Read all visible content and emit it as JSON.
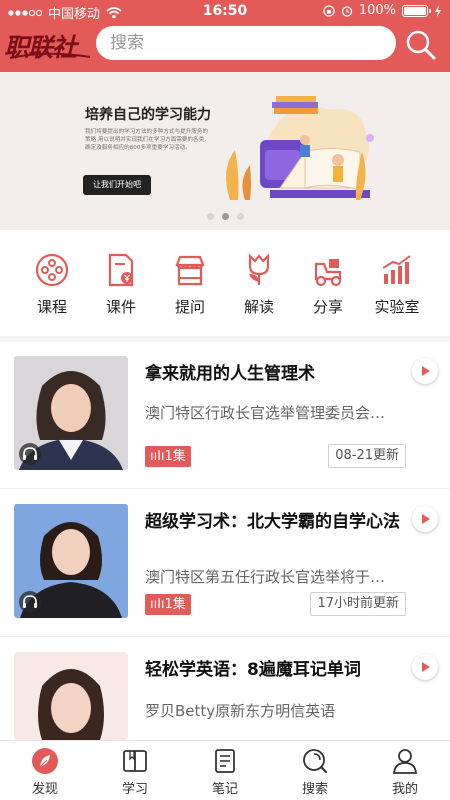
{
  "status_bar": {
    "carrier": "中国移动",
    "time": "16:50",
    "battery": "100%"
  },
  "header": {
    "logo_text": "职联社",
    "search_placeholder": "搜索"
  },
  "banner": {
    "title": "培养自己的学习能力",
    "description": "我们将要提出的学习方法的多种方式与提升服务的策略,用以说明并实现我们在学习方面需要的各类,确定及服务相应的800多项重要学习活动。",
    "cta": "让我们开始吧",
    "page_count": 3,
    "active_page": 2
  },
  "categories": [
    {
      "label": "课程",
      "icon": "film-reel-icon"
    },
    {
      "label": "课件",
      "icon": "document-yen-icon"
    },
    {
      "label": "提问",
      "icon": "storefront-icon"
    },
    {
      "label": "解读",
      "icon": "tulip-icon"
    },
    {
      "label": "分享",
      "icon": "tractor-icon"
    },
    {
      "label": "实验室",
      "icon": "bar-chart-icon"
    }
  ],
  "courses": [
    {
      "title": "拿来就用的人生管理术",
      "subtitle": "澳门特区行政长官选举管理委员会…",
      "episodes": "1集",
      "updated": "08-21更新"
    },
    {
      "title": "超级学习术：北大学霸的自学心法",
      "subtitle": "澳门特区第五任行政长官选举将于…",
      "episodes": "1集",
      "updated": "17小时前更新"
    },
    {
      "title": "轻松学英语：8遍魔耳记单词",
      "subtitle": "罗贝Betty原新东方明信英语",
      "episodes": "",
      "updated": ""
    }
  ],
  "tabbar": [
    {
      "label": "发现",
      "icon": "feather-icon",
      "active": true
    },
    {
      "label": "学习",
      "icon": "book-icon",
      "active": false
    },
    {
      "label": "笔记",
      "icon": "notepad-icon",
      "active": false
    },
    {
      "label": "搜索",
      "icon": "search-icon",
      "active": false
    },
    {
      "label": "我的",
      "icon": "person-icon",
      "active": false
    }
  ],
  "colors": {
    "brand_red": "#e25b59",
    "logo_dark_red": "#7a0f18"
  }
}
